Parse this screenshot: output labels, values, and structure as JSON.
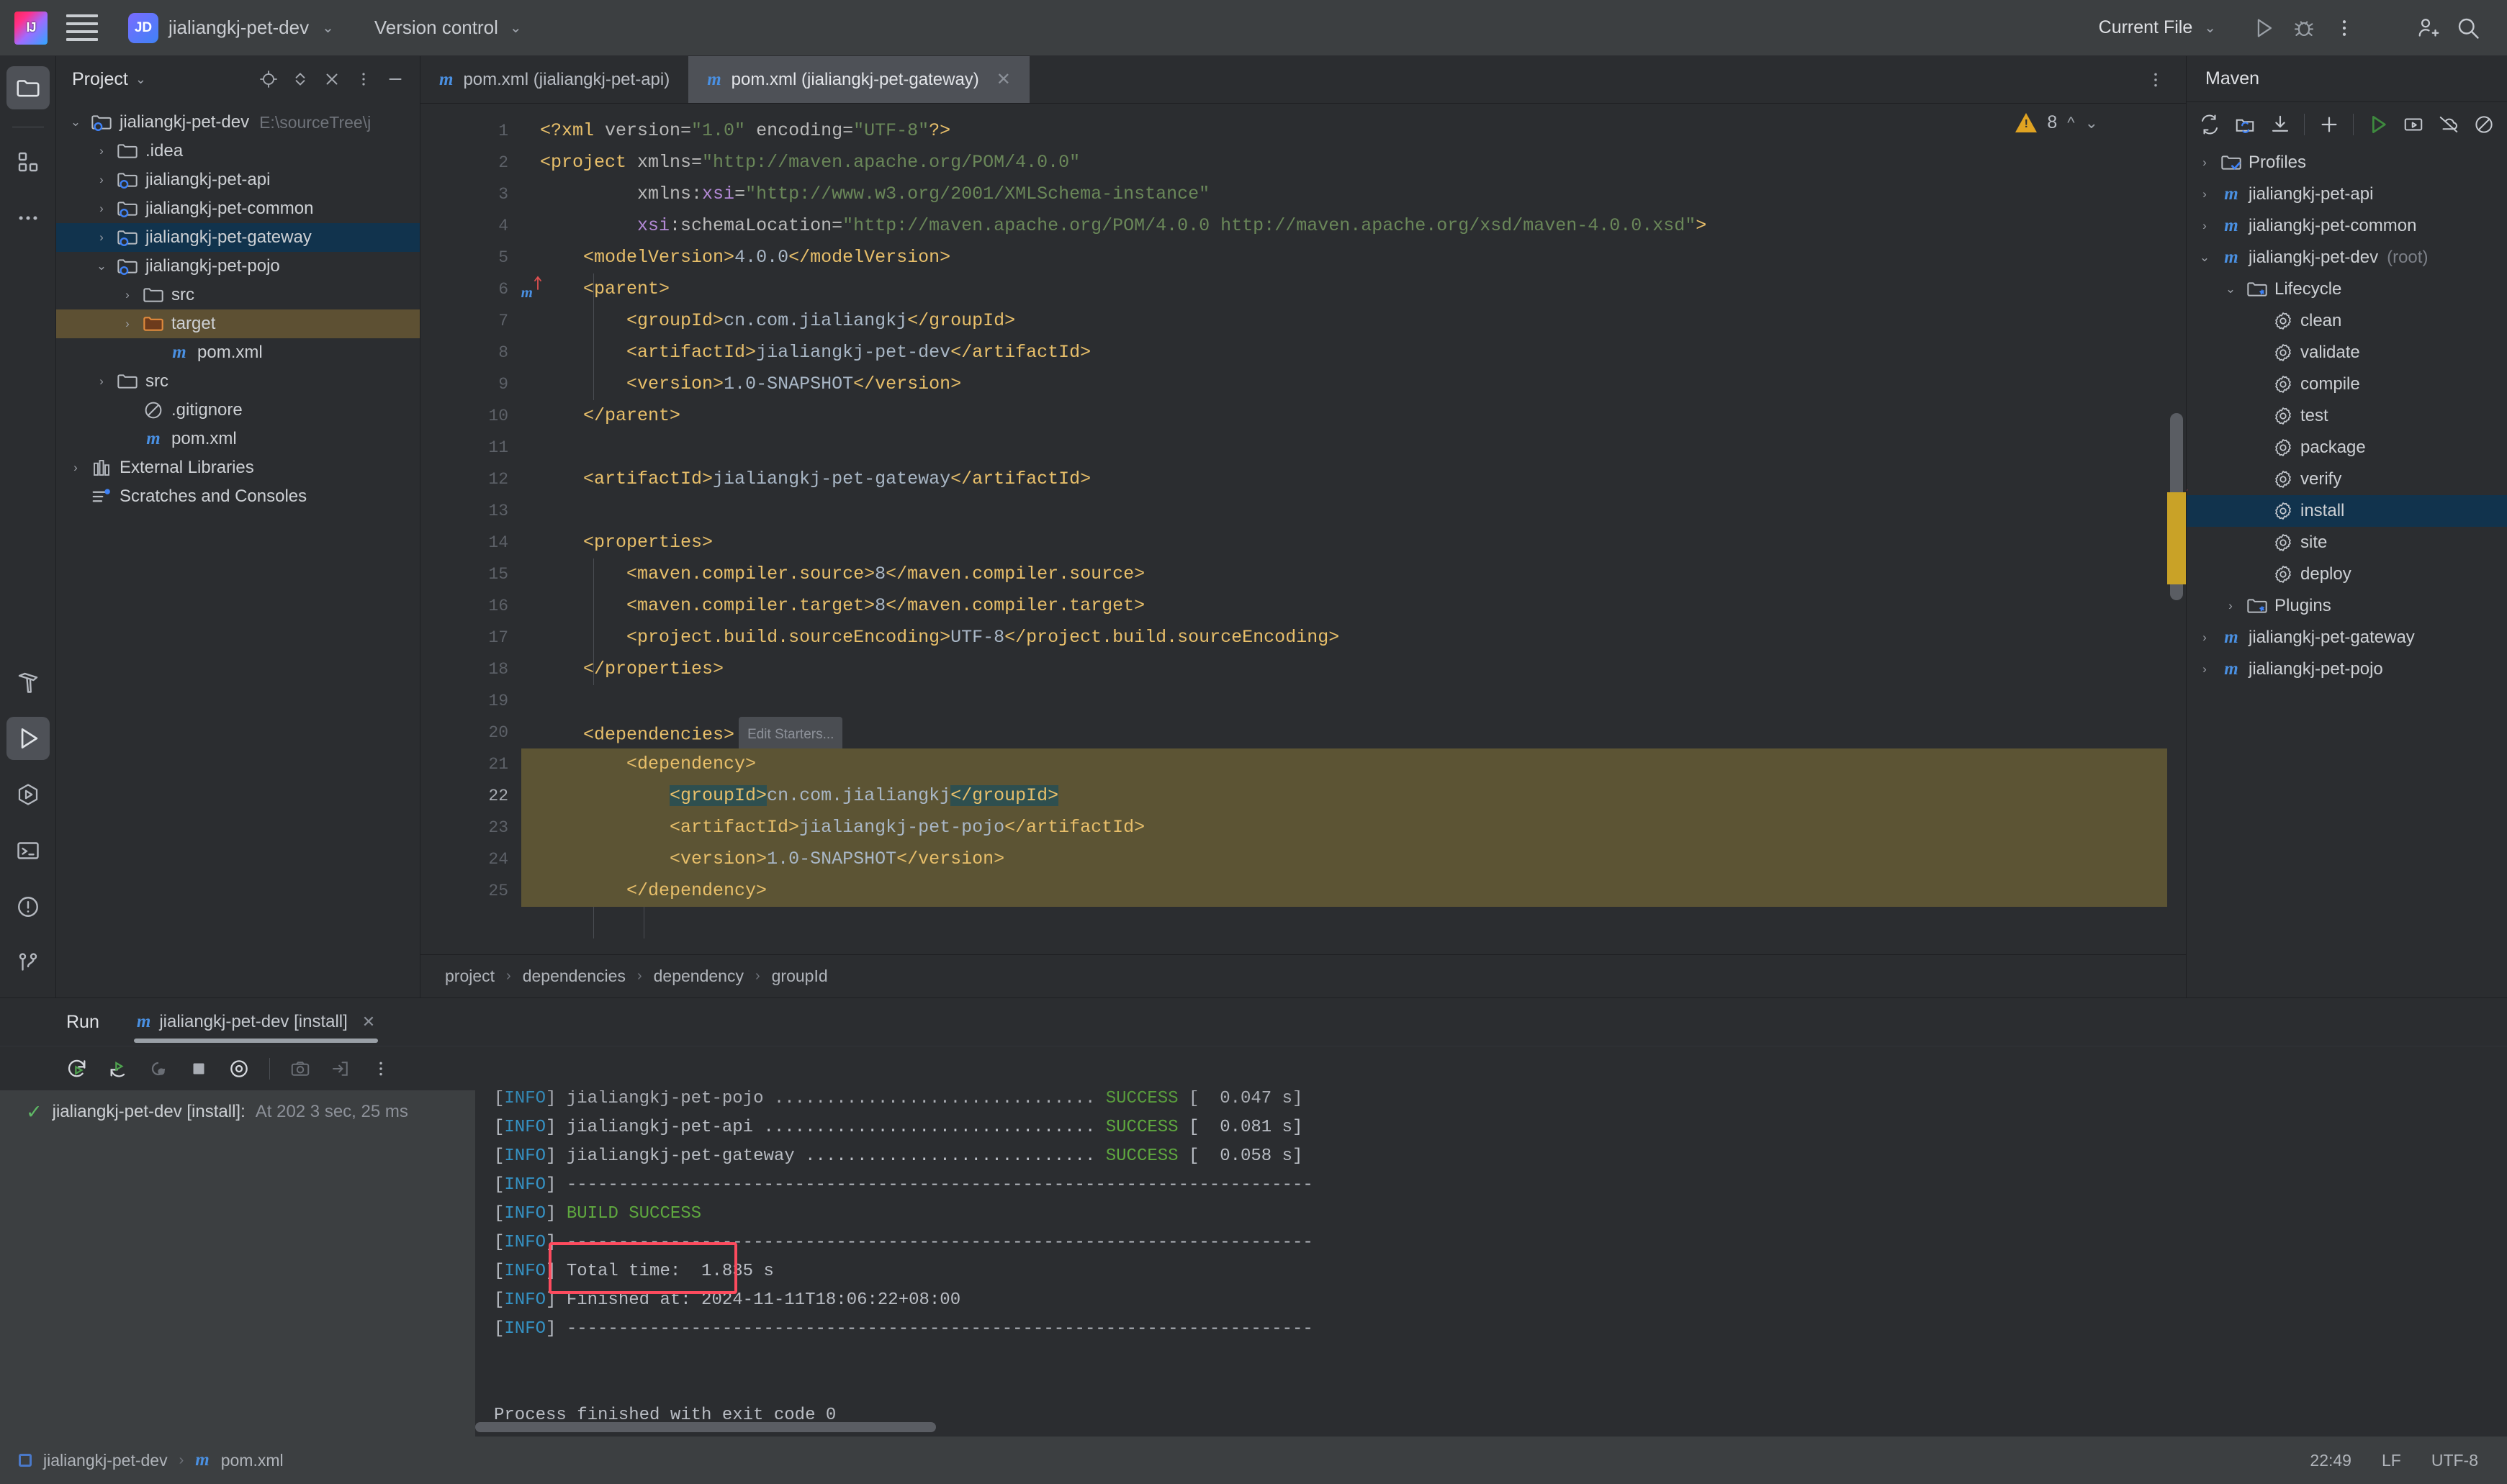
{
  "titlebar": {
    "logo_icon": "intellij-idea-logo",
    "menu_icon": "hamburger-menu-icon",
    "project_badge": "JD",
    "project_name": "jialiangkj-pet-dev",
    "vcs_label": "Version control",
    "run_config_label": "Current File",
    "run_icon": "run-icon",
    "debug_icon": "debug-icon",
    "more_icon": "more-vertical-icon",
    "share_icon": "add-user-icon",
    "search_icon": "search-icon"
  },
  "activitybar": {
    "top": [
      {
        "name": "project-icon",
        "selected": true
      },
      {
        "name": "structure-icon",
        "selected": false
      },
      {
        "name": "more-tools-icon",
        "selected": false
      }
    ],
    "bottom": [
      {
        "name": "build-icon",
        "selected": false
      },
      {
        "name": "run-icon",
        "selected": true
      },
      {
        "name": "services-icon",
        "selected": false
      },
      {
        "name": "terminal-icon",
        "selected": false
      },
      {
        "name": "problems-icon",
        "selected": false
      },
      {
        "name": "version-control-icon",
        "selected": false
      }
    ]
  },
  "project_panel": {
    "title": "Project",
    "tools": [
      "select-opened-file-icon",
      "expand-collapse-icon",
      "collapse-all-icon",
      "options-icon",
      "hide-icon"
    ],
    "tree": [
      {
        "label": "jialiangkj-pet-dev",
        "path": "E:\\sourceTree\\j",
        "indent": 0,
        "arrow": "down",
        "icon": "module-folder-icon",
        "state": "normal"
      },
      {
        "label": ".idea",
        "path": "",
        "indent": 1,
        "arrow": "right",
        "icon": "folder-icon",
        "state": "normal"
      },
      {
        "label": "jialiangkj-pet-api",
        "path": "",
        "indent": 1,
        "arrow": "right",
        "icon": "module-folder-icon",
        "state": "normal"
      },
      {
        "label": "jialiangkj-pet-common",
        "path": "",
        "indent": 1,
        "arrow": "right",
        "icon": "module-folder-icon",
        "state": "normal"
      },
      {
        "label": "jialiangkj-pet-gateway",
        "path": "",
        "indent": 1,
        "arrow": "right",
        "icon": "module-folder-icon",
        "state": "selected"
      },
      {
        "label": "jialiangkj-pet-pojo",
        "path": "",
        "indent": 1,
        "arrow": "down",
        "icon": "module-folder-icon",
        "state": "normal"
      },
      {
        "label": "src",
        "path": "",
        "indent": 2,
        "arrow": "right",
        "icon": "folder-icon",
        "state": "normal"
      },
      {
        "label": "target",
        "path": "",
        "indent": 2,
        "arrow": "right",
        "icon": "target-folder-icon",
        "state": "highlight"
      },
      {
        "label": "pom.xml",
        "path": "",
        "indent": 3,
        "arrow": "none",
        "icon": "maven-file-icon",
        "state": "normal"
      },
      {
        "label": "src",
        "path": "",
        "indent": 1,
        "arrow": "right",
        "icon": "folder-icon",
        "state": "normal"
      },
      {
        "label": ".gitignore",
        "path": "",
        "indent": 2,
        "arrow": "none",
        "icon": "gitignore-icon",
        "state": "normal"
      },
      {
        "label": "pom.xml",
        "path": "",
        "indent": 2,
        "arrow": "none",
        "icon": "maven-file-icon",
        "state": "normal"
      },
      {
        "label": "External Libraries",
        "path": "",
        "indent": 0,
        "arrow": "right",
        "icon": "libraries-icon",
        "state": "normal"
      },
      {
        "label": "Scratches and Consoles",
        "path": "",
        "indent": 0,
        "arrow": "none",
        "icon": "scratches-icon",
        "state": "normal"
      }
    ]
  },
  "editor": {
    "tabs": [
      {
        "label": "pom.xml (jialiangkj-pet-api)",
        "icon": "maven-file-icon",
        "active": false,
        "closable": false
      },
      {
        "label": "pom.xml (jialiangkj-pet-gateway)",
        "icon": "maven-file-icon",
        "active": true,
        "closable": true
      }
    ],
    "tab_options_icon": "more-vertical-icon",
    "inspection": {
      "warning_count": "8",
      "warning_icon": "warning-triangle-icon",
      "up_icon": "chevron-up-icon",
      "down_icon": "chevron-down-icon"
    },
    "lines": [
      {
        "n": "1",
        "indent": 0,
        "segments": [
          {
            "t": "<?xml ",
            "c": "tag"
          },
          {
            "t": "version=",
            "c": "attr"
          },
          {
            "t": "\"1.0\"",
            "c": "str"
          },
          {
            "t": " encoding=",
            "c": "attr"
          },
          {
            "t": "\"UTF-8\"",
            "c": "str"
          },
          {
            "t": "?>",
            "c": "tag"
          }
        ],
        "hl": false,
        "gutter_mark": ""
      },
      {
        "n": "2",
        "indent": 0,
        "segments": [
          {
            "t": "<project ",
            "c": "tag"
          },
          {
            "t": "xmlns=",
            "c": "attr"
          },
          {
            "t": "\"http://maven.apache.org/POM/4.0.0\"",
            "c": "str"
          }
        ],
        "hl": false,
        "gutter_mark": ""
      },
      {
        "n": "3",
        "indent": 0,
        "segments": [
          {
            "t": "         xmlns:",
            "c": "attr"
          },
          {
            "t": "xsi",
            "c": "attr-ns"
          },
          {
            "t": "=",
            "c": "attr"
          },
          {
            "t": "\"http://www.w3.org/2001/XMLSchema-instance\"",
            "c": "str"
          }
        ],
        "hl": false,
        "gutter_mark": ""
      },
      {
        "n": "4",
        "indent": 0,
        "segments": [
          {
            "t": "         ",
            "c": "attr"
          },
          {
            "t": "xsi",
            "c": "attr-ns"
          },
          {
            "t": ":schemaLocation=",
            "c": "attr"
          },
          {
            "t": "\"http://maven.apache.org/POM/4.0.0 http://maven.apache.org/xsd/maven-4.0.0.xsd\"",
            "c": "str"
          },
          {
            "t": ">",
            "c": "tag"
          }
        ],
        "hl": false,
        "gutter_mark": ""
      },
      {
        "n": "5",
        "indent": 1,
        "segments": [
          {
            "t": "<modelVersion>",
            "c": "tag"
          },
          {
            "t": "4.0.0",
            "c": "txt"
          },
          {
            "t": "</modelVersion>",
            "c": "tag"
          }
        ],
        "hl": false,
        "gutter_mark": ""
      },
      {
        "n": "6",
        "indent": 1,
        "segments": [
          {
            "t": "<parent>",
            "c": "tag"
          }
        ],
        "hl": false,
        "gutter_mark": "maven-parent-icon"
      },
      {
        "n": "7",
        "indent": 2,
        "segments": [
          {
            "t": "<groupId>",
            "c": "tag"
          },
          {
            "t": "cn.com.jialiangkj",
            "c": "txt"
          },
          {
            "t": "</groupId>",
            "c": "tag"
          }
        ],
        "hl": false,
        "gutter_mark": ""
      },
      {
        "n": "8",
        "indent": 2,
        "segments": [
          {
            "t": "<artifactId>",
            "c": "tag"
          },
          {
            "t": "jialiangkj-pet-dev",
            "c": "txt"
          },
          {
            "t": "</artifactId>",
            "c": "tag"
          }
        ],
        "hl": false,
        "gutter_mark": ""
      },
      {
        "n": "9",
        "indent": 2,
        "segments": [
          {
            "t": "<version>",
            "c": "tag"
          },
          {
            "t": "1.0-SNAPSHOT",
            "c": "txt"
          },
          {
            "t": "</version>",
            "c": "tag"
          }
        ],
        "hl": false,
        "gutter_mark": ""
      },
      {
        "n": "10",
        "indent": 1,
        "segments": [
          {
            "t": "</parent>",
            "c": "tag"
          }
        ],
        "hl": false,
        "gutter_mark": ""
      },
      {
        "n": "11",
        "indent": 0,
        "segments": [],
        "hl": false,
        "gutter_mark": ""
      },
      {
        "n": "12",
        "indent": 1,
        "segments": [
          {
            "t": "<artifactId>",
            "c": "tag"
          },
          {
            "t": "jialiangkj-pet-gateway",
            "c": "txt"
          },
          {
            "t": "</artifactId>",
            "c": "tag"
          }
        ],
        "hl": false,
        "gutter_mark": ""
      },
      {
        "n": "13",
        "indent": 0,
        "segments": [],
        "hl": false,
        "gutter_mark": ""
      },
      {
        "n": "14",
        "indent": 1,
        "segments": [
          {
            "t": "<properties>",
            "c": "tag"
          }
        ],
        "hl": false,
        "gutter_mark": ""
      },
      {
        "n": "15",
        "indent": 2,
        "segments": [
          {
            "t": "<maven.compiler.source>",
            "c": "tag"
          },
          {
            "t": "8",
            "c": "txt"
          },
          {
            "t": "</maven.compiler.source>",
            "c": "tag"
          }
        ],
        "hl": false,
        "gutter_mark": ""
      },
      {
        "n": "16",
        "indent": 2,
        "segments": [
          {
            "t": "<maven.compiler.target>",
            "c": "tag"
          },
          {
            "t": "8",
            "c": "txt"
          },
          {
            "t": "</maven.compiler.target>",
            "c": "tag"
          }
        ],
        "hl": false,
        "gutter_mark": ""
      },
      {
        "n": "17",
        "indent": 2,
        "segments": [
          {
            "t": "<project.build.sourceEncoding>",
            "c": "tag"
          },
          {
            "t": "UTF-8",
            "c": "txt"
          },
          {
            "t": "</project.build.sourceEncoding>",
            "c": "tag"
          }
        ],
        "hl": false,
        "gutter_mark": ""
      },
      {
        "n": "18",
        "indent": 1,
        "segments": [
          {
            "t": "</properties>",
            "c": "tag"
          }
        ],
        "hl": false,
        "gutter_mark": ""
      },
      {
        "n": "19",
        "indent": 0,
        "segments": [],
        "hl": false,
        "gutter_mark": ""
      },
      {
        "n": "20",
        "indent": 1,
        "segments": [
          {
            "t": "<dependencies>",
            "c": "tag"
          }
        ],
        "hl": false,
        "gutter_mark": "",
        "badge": "Edit Starters..."
      },
      {
        "n": "21",
        "indent": 2,
        "segments": [
          {
            "t": "<dependency>",
            "c": "tag"
          }
        ],
        "hl": true,
        "gutter_mark": ""
      },
      {
        "n": "22",
        "indent": 3,
        "segments": [
          {
            "t": "<groupId>",
            "c": "tag sel-tok"
          },
          {
            "t": "cn.com.jialiangkj",
            "c": "txt"
          },
          {
            "t": "</groupId>",
            "c": "tag sel-tok"
          }
        ],
        "hl": true,
        "gutter_mark": "",
        "current": true
      },
      {
        "n": "23",
        "indent": 3,
        "segments": [
          {
            "t": "<artifactId>",
            "c": "tag"
          },
          {
            "t": "jialiangkj-pet-pojo",
            "c": "txt"
          },
          {
            "t": "</artifactId>",
            "c": "tag"
          }
        ],
        "hl": true,
        "gutter_mark": ""
      },
      {
        "n": "24",
        "indent": 3,
        "segments": [
          {
            "t": "<version>",
            "c": "tag"
          },
          {
            "t": "1.0-SNAPSHOT",
            "c": "txt"
          },
          {
            "t": "</version>",
            "c": "tag"
          }
        ],
        "hl": true,
        "gutter_mark": ""
      },
      {
        "n": "25",
        "indent": 2,
        "segments": [
          {
            "t": "</dependency>",
            "c": "tag"
          }
        ],
        "hl": true,
        "gutter_mark": ""
      }
    ],
    "breadcrumb": [
      "project",
      "dependencies",
      "dependency",
      "groupId"
    ]
  },
  "maven_panel": {
    "title": "Maven",
    "tools": [
      {
        "name": "reload-all-icon"
      },
      {
        "name": "reload-project-icon"
      },
      {
        "name": "download-sources-icon"
      },
      {
        "name": "add-maven-project-icon"
      },
      {
        "name": "run-maven-build-icon"
      },
      {
        "name": "execute-goal-icon"
      },
      {
        "name": "toggle-offline-icon"
      },
      {
        "name": "skip-tests-icon"
      }
    ],
    "tree": [
      {
        "label": "Profiles",
        "indent": 0,
        "arrow": "right",
        "icon": "profiles-folder-icon",
        "state": "normal",
        "dim": ""
      },
      {
        "label": "jialiangkj-pet-api",
        "indent": 0,
        "arrow": "right",
        "icon": "maven-module-icon",
        "state": "normal",
        "dim": ""
      },
      {
        "label": "jialiangkj-pet-common",
        "indent": 0,
        "arrow": "right",
        "icon": "maven-module-icon",
        "state": "normal",
        "dim": ""
      },
      {
        "label": "jialiangkj-pet-dev",
        "indent": 0,
        "arrow": "down",
        "icon": "maven-module-icon",
        "state": "normal",
        "dim": "(root)"
      },
      {
        "label": "Lifecycle",
        "indent": 1,
        "arrow": "down",
        "icon": "lifecycle-folder-icon",
        "state": "normal",
        "dim": ""
      },
      {
        "label": "clean",
        "indent": 2,
        "arrow": "none",
        "icon": "goal-icon",
        "state": "normal",
        "dim": ""
      },
      {
        "label": "validate",
        "indent": 2,
        "arrow": "none",
        "icon": "goal-icon",
        "state": "normal",
        "dim": ""
      },
      {
        "label": "compile",
        "indent": 2,
        "arrow": "none",
        "icon": "goal-icon",
        "state": "normal",
        "dim": ""
      },
      {
        "label": "test",
        "indent": 2,
        "arrow": "none",
        "icon": "goal-icon",
        "state": "normal",
        "dim": ""
      },
      {
        "label": "package",
        "indent": 2,
        "arrow": "none",
        "icon": "goal-icon",
        "state": "normal",
        "dim": ""
      },
      {
        "label": "verify",
        "indent": 2,
        "arrow": "none",
        "icon": "goal-icon",
        "state": "normal",
        "dim": ""
      },
      {
        "label": "install",
        "indent": 2,
        "arrow": "none",
        "icon": "goal-icon",
        "state": "selected",
        "dim": ""
      },
      {
        "label": "site",
        "indent": 2,
        "arrow": "none",
        "icon": "goal-icon",
        "state": "normal",
        "dim": ""
      },
      {
        "label": "deploy",
        "indent": 2,
        "arrow": "none",
        "icon": "goal-icon",
        "state": "normal",
        "dim": ""
      },
      {
        "label": "Plugins",
        "indent": 1,
        "arrow": "right",
        "icon": "plugins-folder-icon",
        "state": "normal",
        "dim": ""
      },
      {
        "label": "jialiangkj-pet-gateway",
        "indent": 0,
        "arrow": "right",
        "icon": "maven-module-icon",
        "state": "normal",
        "dim": ""
      },
      {
        "label": "jialiangkj-pet-pojo",
        "indent": 0,
        "arrow": "right",
        "icon": "maven-module-icon",
        "state": "normal",
        "dim": ""
      }
    ],
    "annotation_arrow_color": "#fd4b5e"
  },
  "run_panel": {
    "label": "Run",
    "tab": {
      "label": "jialiangkj-pet-dev [install]",
      "icon": "maven-file-icon",
      "close_icon": "close-icon"
    },
    "toolbar": [
      {
        "name": "rerun-icon",
        "enabled": true
      },
      {
        "name": "rerun-failed-icon",
        "enabled": true
      },
      {
        "name": "restart-icon",
        "enabled": false
      },
      {
        "name": "stop-icon",
        "enabled": true
      },
      {
        "name": "toggle-soft-wrap-icon",
        "enabled": true
      },
      {
        "name": "screenshot-icon",
        "enabled": false
      },
      {
        "name": "export-icon",
        "enabled": false
      },
      {
        "name": "more-vertical-icon",
        "enabled": true
      }
    ],
    "tree_row": {
      "status_icon": "check-icon",
      "title": "jialiangkj-pet-dev [install]:",
      "detail": "At 202 3 sec, 25 ms"
    },
    "console_lines": [
      {
        "prefix": "[INFO]",
        "rest": " jialiangkj-pet-pojo ............................... ",
        "status": "SUCCESS",
        "tail": " [  0.047 s]",
        "clipped": true
      },
      {
        "prefix": "[INFO]",
        "rest": " jialiangkj-pet-api ................................ ",
        "status": "SUCCESS",
        "tail": " [  0.081 s]",
        "clipped": false
      },
      {
        "prefix": "[INFO]",
        "rest": " jialiangkj-pet-gateway ............................ ",
        "status": "SUCCESS",
        "tail": " [  0.058 s]",
        "clipped": false
      },
      {
        "prefix": "[INFO]",
        "rest": " ------------------------------------------------------------------------",
        "status": "",
        "tail": "",
        "clipped": false
      },
      {
        "prefix": "[INFO]",
        "rest": " ",
        "status": "BUILD SUCCESS",
        "tail": "",
        "clipped": false,
        "boxed": true
      },
      {
        "prefix": "[INFO]",
        "rest": " ------------------------------------------------------------------------",
        "status": "",
        "tail": "",
        "clipped": false
      },
      {
        "prefix": "[INFO]",
        "rest": " Total time:  1.835 s",
        "status": "",
        "tail": "",
        "clipped": false
      },
      {
        "prefix": "[INFO]",
        "rest": " Finished at: 2024-11-11T18:06:22+08:00",
        "status": "",
        "tail": "",
        "clipped": false
      },
      {
        "prefix": "[INFO]",
        "rest": " ------------------------------------------------------------------------",
        "status": "",
        "tail": "",
        "clipped": false
      },
      {
        "prefix": "",
        "rest": "",
        "status": "",
        "tail": "",
        "clipped": false
      },
      {
        "prefix": "",
        "rest": "",
        "status": "",
        "tail": "",
        "clipped": false
      },
      {
        "prefix": "",
        "rest": "Process finished with exit code 0",
        "status": "",
        "tail": "",
        "clipped": false
      }
    ]
  },
  "statusbar": {
    "breadcrumb": [
      "jialiangkj-pet-dev",
      "pom.xml"
    ],
    "file_icon": "maven-file-icon",
    "time": "22:49",
    "line_separator": "LF",
    "encoding": "UTF-8"
  },
  "colors": {
    "accent_blue": "#3592c4",
    "success_green": "#5fa83f",
    "selection_blue": "#11334d",
    "annotation_red": "#fd4b5e",
    "warning_amber": "#e0a322",
    "highlight_olive": "#5c5434"
  }
}
